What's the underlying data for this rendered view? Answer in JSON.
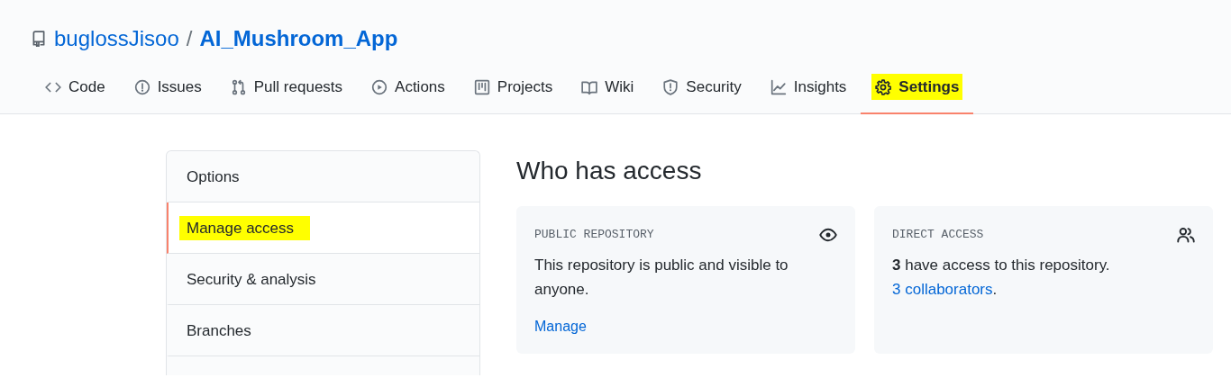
{
  "repo": {
    "owner": "buglossJisoo",
    "separator": "/",
    "name": "AI_Mushroom_App"
  },
  "tabs": [
    {
      "label": "Code",
      "selected": false,
      "highlighted": false
    },
    {
      "label": "Issues",
      "selected": false,
      "highlighted": false
    },
    {
      "label": "Pull requests",
      "selected": false,
      "highlighted": false
    },
    {
      "label": "Actions",
      "selected": false,
      "highlighted": false
    },
    {
      "label": "Projects",
      "selected": false,
      "highlighted": false
    },
    {
      "label": "Wiki",
      "selected": false,
      "highlighted": false
    },
    {
      "label": "Security",
      "selected": false,
      "highlighted": false
    },
    {
      "label": "Insights",
      "selected": false,
      "highlighted": false
    },
    {
      "label": "Settings",
      "selected": true,
      "highlighted": true
    }
  ],
  "sidebar": {
    "items": [
      {
        "label": "Options",
        "selected": false,
        "highlighted": false
      },
      {
        "label": "Manage access",
        "selected": true,
        "highlighted": true
      },
      {
        "label": "Security & analysis",
        "selected": false,
        "highlighted": false
      },
      {
        "label": "Branches",
        "selected": false,
        "highlighted": false
      }
    ]
  },
  "heading": "Who has access",
  "cards": [
    {
      "title": "PUBLIC REPOSITORY",
      "text": "This repository is public and visible to anyone.",
      "link": "Manage"
    },
    {
      "title": "DIRECT ACCESS",
      "text": "**3** have access to this repository.",
      "inline_link": "3 collaborators",
      "after": "."
    }
  ]
}
